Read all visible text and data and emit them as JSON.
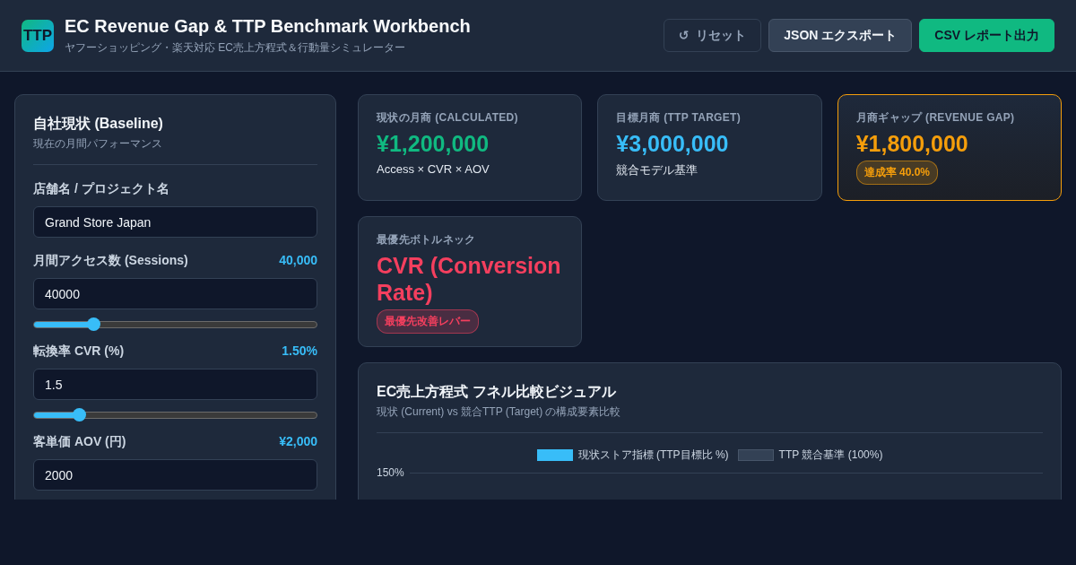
{
  "header": {
    "logo": "TTP",
    "title": "EC Revenue Gap & TTP Benchmark Workbench",
    "subtitle": "ヤフーショッピング・楽天対応 EC売上方程式＆行動量シミュレーター",
    "buttons": [
      {
        "label": "リセット",
        "icon": "↺",
        "kind": "ghost"
      },
      {
        "label": "JSON エクスポート",
        "kind": "secondary"
      },
      {
        "label": "CSV レポート出力",
        "kind": "primary"
      }
    ]
  },
  "baseline": {
    "title": "自社現状 (Baseline)",
    "subtitle": "現在の月間パフォーマンス",
    "fields": [
      {
        "kind": "text",
        "label": "店舗名 / プロジェクト名",
        "value": "Grand Store Japan"
      },
      {
        "kind": "range",
        "label": "月間アクセス数 (Sessions)",
        "reading": "40,000",
        "value": "40000",
        "level": 0.21
      },
      {
        "kind": "range",
        "label": "転換率 CVR (%)",
        "reading": "1.50%",
        "value": "1.5",
        "level": 0.16
      },
      {
        "kind": "range",
        "label": "客単価 AOV (円)",
        "reading": "¥2,000",
        "value": "2000"
      }
    ]
  },
  "cards": [
    {
      "label": "現状の月商 (CALCULATED)",
      "value": "¥1,200,000",
      "color": "#10b981",
      "kind": "plain",
      "note": "Access × CVR × AOV"
    },
    {
      "label": "目標月商 (TTP TARGET)",
      "value": "¥3,000,000",
      "color": "#38bdf8",
      "kind": "plain",
      "note": "競合モデル基準"
    },
    {
      "label": "月商ギャップ (REVENUE GAP)",
      "value": "¥1,800,000",
      "color": "#f59e0b",
      "kind": "highlight",
      "badge": "達成率 40.0%"
    },
    {
      "label": "最優先ボトルネック",
      "value": "CVR (Conversion Rate)",
      "color": "#f43f5e",
      "kind": "plain",
      "badge": "最優先改善レバー"
    }
  ],
  "funnel": {
    "title": "EC売上方程式 フネル比較ビジュアル",
    "subtitle": "現状 (Current) vs 競合TTP (Target) の構成要素比較",
    "legend": [
      {
        "label": "現状ストア指標 (TTP目標比 %)",
        "color": "#38bdf8"
      },
      {
        "label": "TTP 競合基準 (100%)",
        "color": "#334155"
      }
    ],
    "y_tick": "150%"
  }
}
